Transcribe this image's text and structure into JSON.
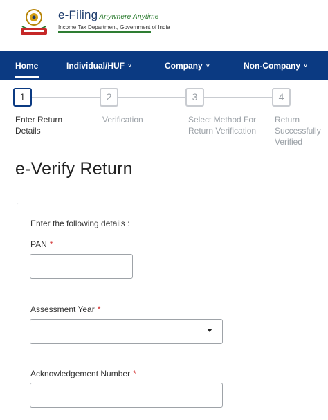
{
  "header": {
    "brand_name": "e-Filing",
    "brand_tagline": "Anywhere Anytime",
    "brand_subtitle": "Income Tax Department, Government of India",
    "emblem_icon": "india-emblem-icon"
  },
  "nav": {
    "items": [
      {
        "label": "Home"
      },
      {
        "label": "Individual/HUF"
      },
      {
        "label": "Company"
      },
      {
        "label": "Non-Company"
      }
    ],
    "dropdown_glyph": "˅"
  },
  "stepper": {
    "steps": [
      {
        "number": "1",
        "label_line1": "Enter Return",
        "label_line2": "Details",
        "label_line3": ""
      },
      {
        "number": "2",
        "label_line1": "Verification",
        "label_line2": "",
        "label_line3": ""
      },
      {
        "number": "3",
        "label_line1": "Select Method For",
        "label_line2": "Return Verification",
        "label_line3": ""
      },
      {
        "number": "4",
        "label_line1": "Return",
        "label_line2": "Successfully",
        "label_line3": "Verified"
      }
    ]
  },
  "page": {
    "title": "e-Verify Return"
  },
  "form": {
    "intro": "Enter the following details :",
    "required_mark": "*",
    "pan": {
      "label": "PAN",
      "value": ""
    },
    "assessment_year": {
      "label": "Assessment Year",
      "selected": ""
    },
    "ack_number": {
      "label": "Acknowledgement Number",
      "value": ""
    }
  },
  "colors": {
    "nav_background": "#0b3a82",
    "brand_blue": "#1b3a6b",
    "brand_green": "#2e7d32",
    "required_red": "#d32f2f"
  }
}
